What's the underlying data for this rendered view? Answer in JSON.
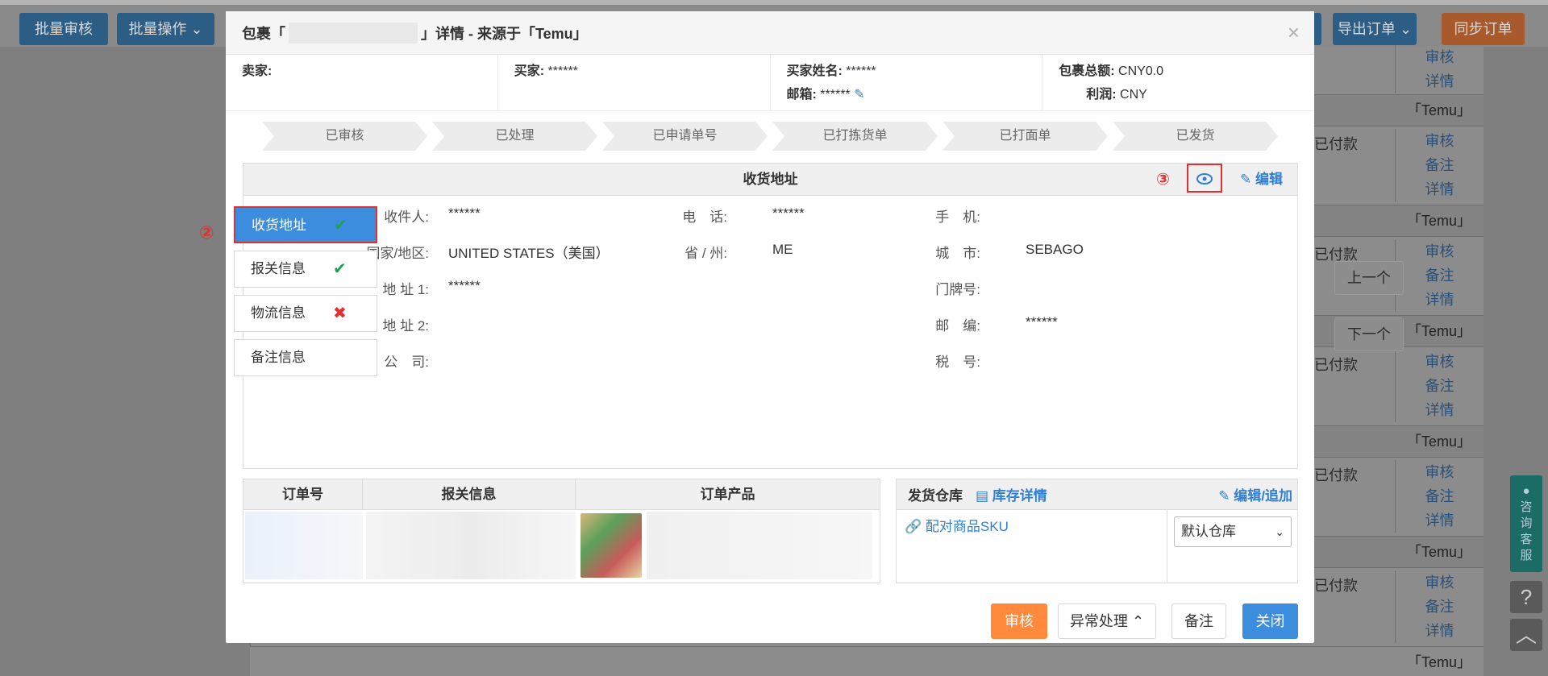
{
  "background": {
    "top_buttons": {
      "batch_review": "批量审核",
      "batch_operation": "批量操作",
      "export_orders": "导出订单",
      "sync_orders": "同步订单"
    },
    "row_links": {
      "review": "审核",
      "note": "备注",
      "detail": "详情"
    },
    "row_source": "「Temu」",
    "row_status_fragment": "已付款",
    "nav": {
      "prev": "上一个",
      "next": "下一个"
    },
    "service": "咨询客服"
  },
  "modal": {
    "title_prefix": "包裹「",
    "title_suffix": "」详情 - 来源于「Temu」",
    "close": "×",
    "info": {
      "seller_label": "卖家:",
      "seller_value": "",
      "buyer_label": "买家:",
      "buyer_value": "******",
      "buyer_name_label": "买家姓名:",
      "buyer_name_value": "******",
      "email_label": "邮箱:",
      "email_value": "******",
      "total_label": "包裹总额:",
      "total_value": "CNY0.0",
      "profit_label": "利润:",
      "profit_value": "CNY"
    },
    "steps": [
      "已审核",
      "已处理",
      "已申请单号",
      "已打拣货单",
      "已打面单",
      "已发货"
    ],
    "address": {
      "heading": "收货地址",
      "annotation_3": "③",
      "edit_label": "编辑",
      "fields": {
        "recipient_label": "收件人:",
        "recipient_value": "******",
        "phone_label": "电　话:",
        "phone_value": "******",
        "mobile_label": "手　机:",
        "mobile_value": "",
        "country_label": "国家/地区:",
        "country_value": "UNITED STATES（美国）",
        "state_label": "省 / 州:",
        "state_value": "ME",
        "city_label": "城　市:",
        "city_value": "SEBAGO",
        "addr1_label": "地 址 1:",
        "addr1_value": "******",
        "house_label": "门牌号:",
        "house_value": "",
        "addr2_label": "地 址 2:",
        "addr2_value": "",
        "zip_label": "邮　编:",
        "zip_value": "******",
        "company_label": "公　司:",
        "company_value": "",
        "tax_label": "税　号:",
        "tax_value": ""
      }
    },
    "tabs": {
      "annotation_2": "②",
      "items": [
        {
          "label": "收货地址",
          "mark": "✔"
        },
        {
          "label": "报关信息",
          "mark": "✔"
        },
        {
          "label": "物流信息",
          "mark": "✖"
        },
        {
          "label": "备注信息",
          "mark": ""
        }
      ]
    },
    "order_table": {
      "headers": [
        "订单号",
        "报关信息",
        "订单产品"
      ]
    },
    "warehouse": {
      "heading": "发货仓库",
      "stock_detail": "库存详情",
      "edit_add": "编辑/追加",
      "pair_sku": "配对商品SKU",
      "selected": "默认仓库"
    },
    "footer": {
      "review": "审核",
      "exception": "异常处理",
      "note": "备注",
      "close": "关闭"
    }
  }
}
